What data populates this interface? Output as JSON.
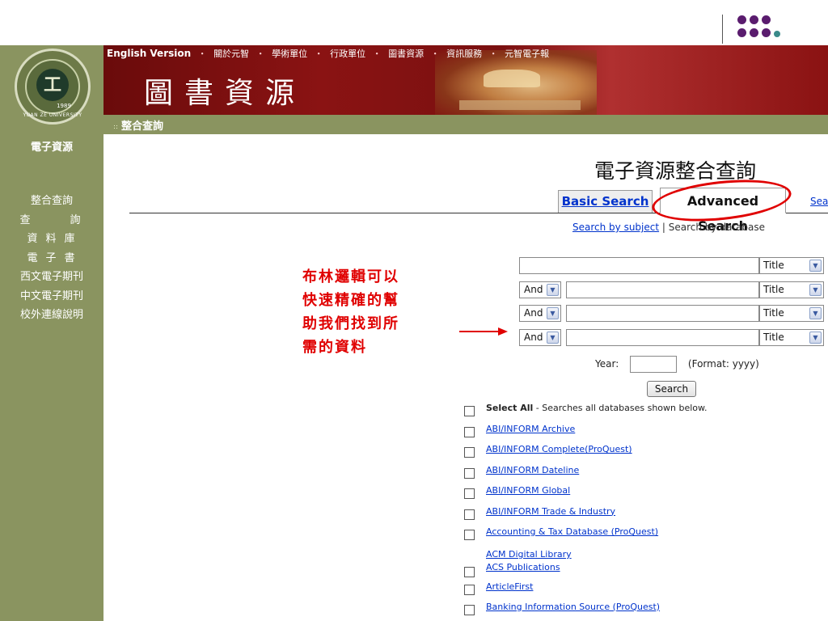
{
  "colors": {
    "accent_red": "#e00000",
    "banner_red": "#8a1313",
    "sidebar_olive": "#8a9460",
    "link_blue": "#0033cc",
    "dot_purple": "#5a1c6e",
    "dot_teal": "#3a8a8a"
  },
  "logo": {
    "year": "1989",
    "university": "YUAN ZE UNIVERSITY"
  },
  "sidebar": {
    "section_title": "電子資源",
    "items": [
      {
        "label": "整合查詢"
      },
      {
        "label": "查　詢"
      },
      {
        "label": "資料庫"
      },
      {
        "label": "電子書"
      },
      {
        "label": "西文電子期刊"
      },
      {
        "label": "中文電子期刊"
      },
      {
        "label": "校外連線說明"
      }
    ]
  },
  "header": {
    "nav": [
      "English Version",
      "關於元智",
      "學術單位",
      "行政單位",
      "圖書資源",
      "資訊服務",
      "元智電子報"
    ],
    "nav_separator": "・",
    "title": "圖書資源"
  },
  "breadcrumb": "整合查詢",
  "main": {
    "title": "電子資源整合查詢",
    "tabs": [
      {
        "label": "Basic Search"
      },
      {
        "label": "Advanced Search"
      },
      {
        "label": "Sea"
      }
    ],
    "sub_links": {
      "subject": "Search by subject",
      "separator": " | ",
      "database": "Search by database"
    },
    "rows": [
      {
        "bool": "",
        "field": "Title"
      },
      {
        "bool": "And",
        "field": "Title"
      },
      {
        "bool": "And",
        "field": "Title"
      },
      {
        "bool": "And",
        "field": "Title"
      }
    ],
    "year_label": "Year:",
    "year_format": "(Format: yyyy)",
    "search_button": "Search"
  },
  "db_list": {
    "select_all_bold": "Select All",
    "select_all_rest": " - Searches all databases shown below.",
    "items": [
      "ABI/INFORM Archive",
      "ABI/INFORM Complete(ProQuest)",
      "ABI/INFORM Dateline",
      "ABI/INFORM Global",
      "ABI/INFORM Trade & Industry",
      "Accounting & Tax Database (ProQuest)"
    ],
    "plain_item": "ACM Digital Library",
    "items_after": [
      "ACS Publications",
      "ArticleFirst",
      "Banking Information Source (ProQuest)"
    ]
  },
  "annotation": {
    "lines": [
      "布林邏輯可以",
      "快速精確的幫",
      "助我們找到所",
      "需的資料"
    ]
  },
  "icons": {
    "dropdown": "chevron-down-icon",
    "checkbox": "checkbox-icon",
    "arrow": "right-arrow-icon"
  }
}
